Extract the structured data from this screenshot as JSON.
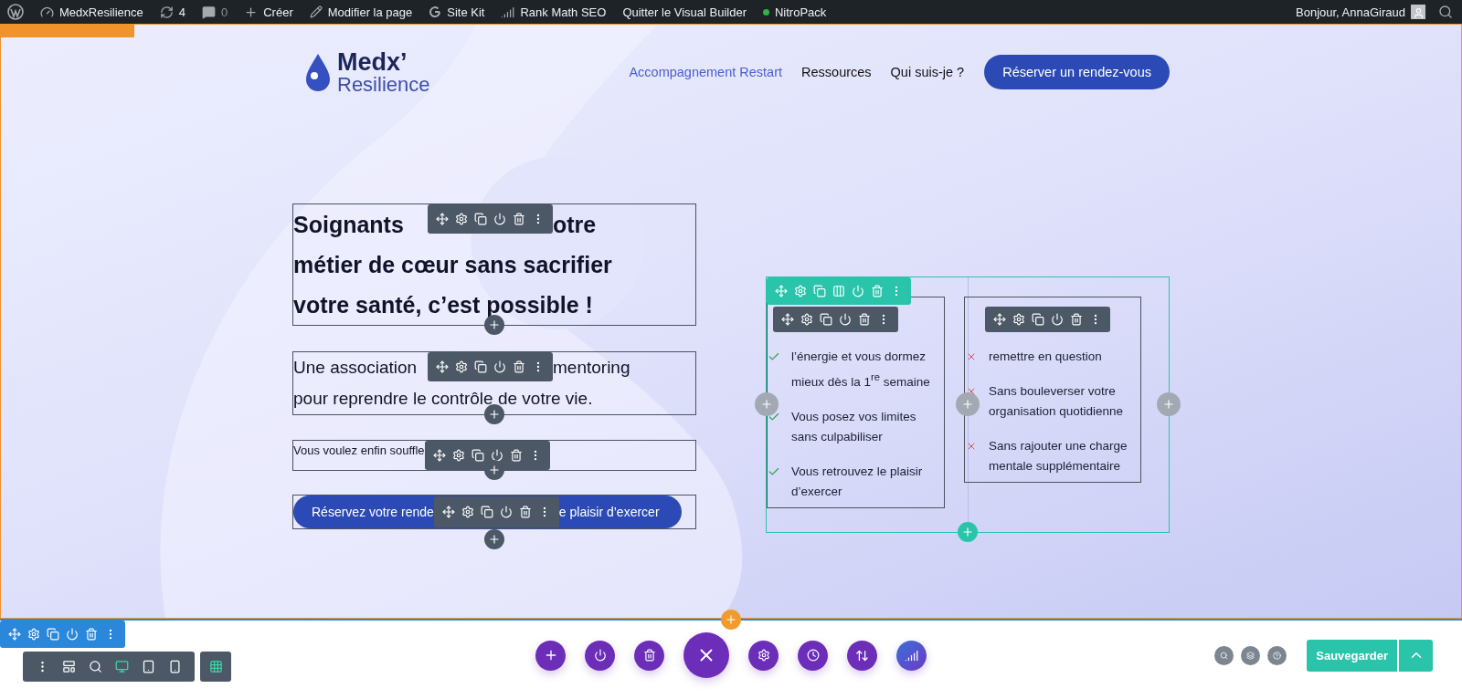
{
  "admin_bar": {
    "items": [
      {
        "kind": "wordpress"
      },
      {
        "kind": "site",
        "label": "MedxResilience"
      },
      {
        "kind": "updates",
        "label": "4"
      },
      {
        "kind": "comments",
        "label": "0"
      },
      {
        "kind": "new",
        "label": "Créer"
      },
      {
        "kind": "edit",
        "label": "Modifier la page"
      },
      {
        "kind": "sitekit",
        "label": "Site Kit"
      },
      {
        "kind": "seo",
        "label": "Rank Math SEO"
      },
      {
        "kind": "text",
        "label": "Quitter le Visual Builder"
      },
      {
        "kind": "status",
        "label": "NitroPack"
      }
    ],
    "greeting": "Bonjour, AnnaGiraud"
  },
  "header": {
    "logo": {
      "name": "Medx’",
      "tagline": "Resilience"
    },
    "nav": [
      {
        "label": "Accompagnement Restart",
        "selected": true
      },
      {
        "label": "Ressources",
        "selected": false
      },
      {
        "label": "Qui suis-je ?",
        "selected": false
      }
    ],
    "cta": "Réserver un rendez-vous"
  },
  "hero": {
    "heading": [
      [
        "Soignants",
        "otre"
      ],
      [
        "métier de cœur sans sacrifier"
      ],
      [
        "votre santé, c’est possible  !"
      ]
    ],
    "intro": [
      [
        "Une association",
        "mentoring"
      ],
      [
        "pour reprendre le contrôle de votre vie."
      ]
    ],
    "note": [
      [
        "Vous voulez enfin souffle"
      ]
    ],
    "button": [
      "Réservez votre rende",
      "e plaisir d’exercer"
    ]
  },
  "benefits": {
    "columns": [
      {
        "items": [
          {
            "kind": "check",
            "text": "l’énergie et vous dormez mieux dès la 1$^{re}$ semaine"
          },
          {
            "kind": "check",
            "text": "Vous posez vos limites sans culpabiliser"
          },
          {
            "kind": "check",
            "text": "Vous retrouvez le plaisir d’exercer"
          }
        ]
      },
      {
        "items": [
          {
            "kind": "cross",
            "text": "remettre en question"
          },
          {
            "kind": "cross",
            "text": "Sans bouleverser votre organisation quotidienne"
          },
          {
            "kind": "cross",
            "text": "Sans rajouter une charge mentale supplémentaire"
          }
        ]
      }
    ]
  },
  "builder": {
    "view_modes": [
      {
        "kind": "desktop",
        "selected": true
      },
      {
        "kind": "tablet",
        "selected": false
      },
      {
        "kind": "phone",
        "selected": false
      }
    ],
    "grid": {
      "on": true
    },
    "actions": [
      {
        "kind": "add"
      },
      {
        "kind": "power"
      },
      {
        "kind": "trash"
      },
      {
        "kind": "close"
      },
      {
        "kind": "settings"
      },
      {
        "kind": "history"
      },
      {
        "kind": "sort"
      },
      {
        "kind": "logo"
      }
    ],
    "save": "Sauvegarder"
  }
}
